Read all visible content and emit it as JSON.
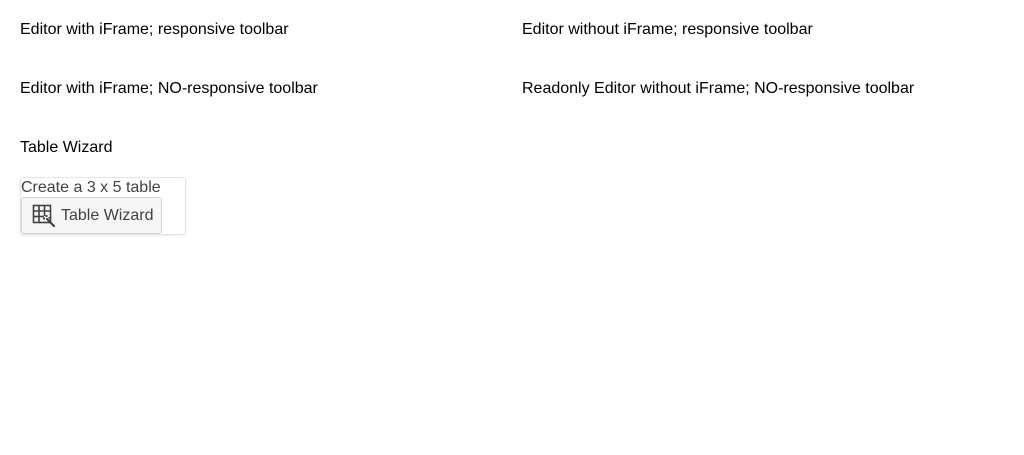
{
  "headings": {
    "editor_iframe_responsive": "Editor with iFrame; responsive toolbar",
    "editor_no_iframe_responsive": "Editor without iFrame; responsive toolbar",
    "editor_iframe_no_responsive": "Editor with iFrame; NO-responsive toolbar",
    "readonly_editor_no_iframe_no_responsive": "Readonly Editor without iFrame; NO-responsive toolbar",
    "table_wizard": "Table Wizard"
  },
  "table_wizard_panel": {
    "text": "Create a 3 x 5 table",
    "button_label": "Table Wizard",
    "button_icon": "table-wizard-icon"
  }
}
